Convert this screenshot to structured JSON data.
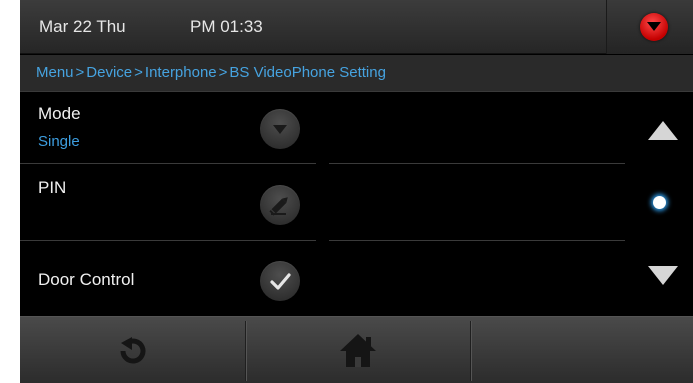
{
  "status": {
    "date": "Mar 22 Thu",
    "time": "PM 01:33"
  },
  "breadcrumb": [
    "Menu",
    "Device",
    "Interphone",
    "BS VideoPhone Setting"
  ],
  "breadcrumb_separator": ">",
  "settings": [
    {
      "label": "Mode",
      "value": "Single",
      "icon": "chevron-down-icon"
    },
    {
      "label": "PIN",
      "value": "",
      "icon": "pencil-icon"
    },
    {
      "label": "Door Control",
      "value": "",
      "icon": "checkmark-icon"
    }
  ],
  "colors": {
    "accent": "#3d9ee0",
    "background": "#000000",
    "alert": "#d40000"
  },
  "bottom_nav": {
    "left_icon": "refresh-icon",
    "center_icon": "home-icon"
  }
}
